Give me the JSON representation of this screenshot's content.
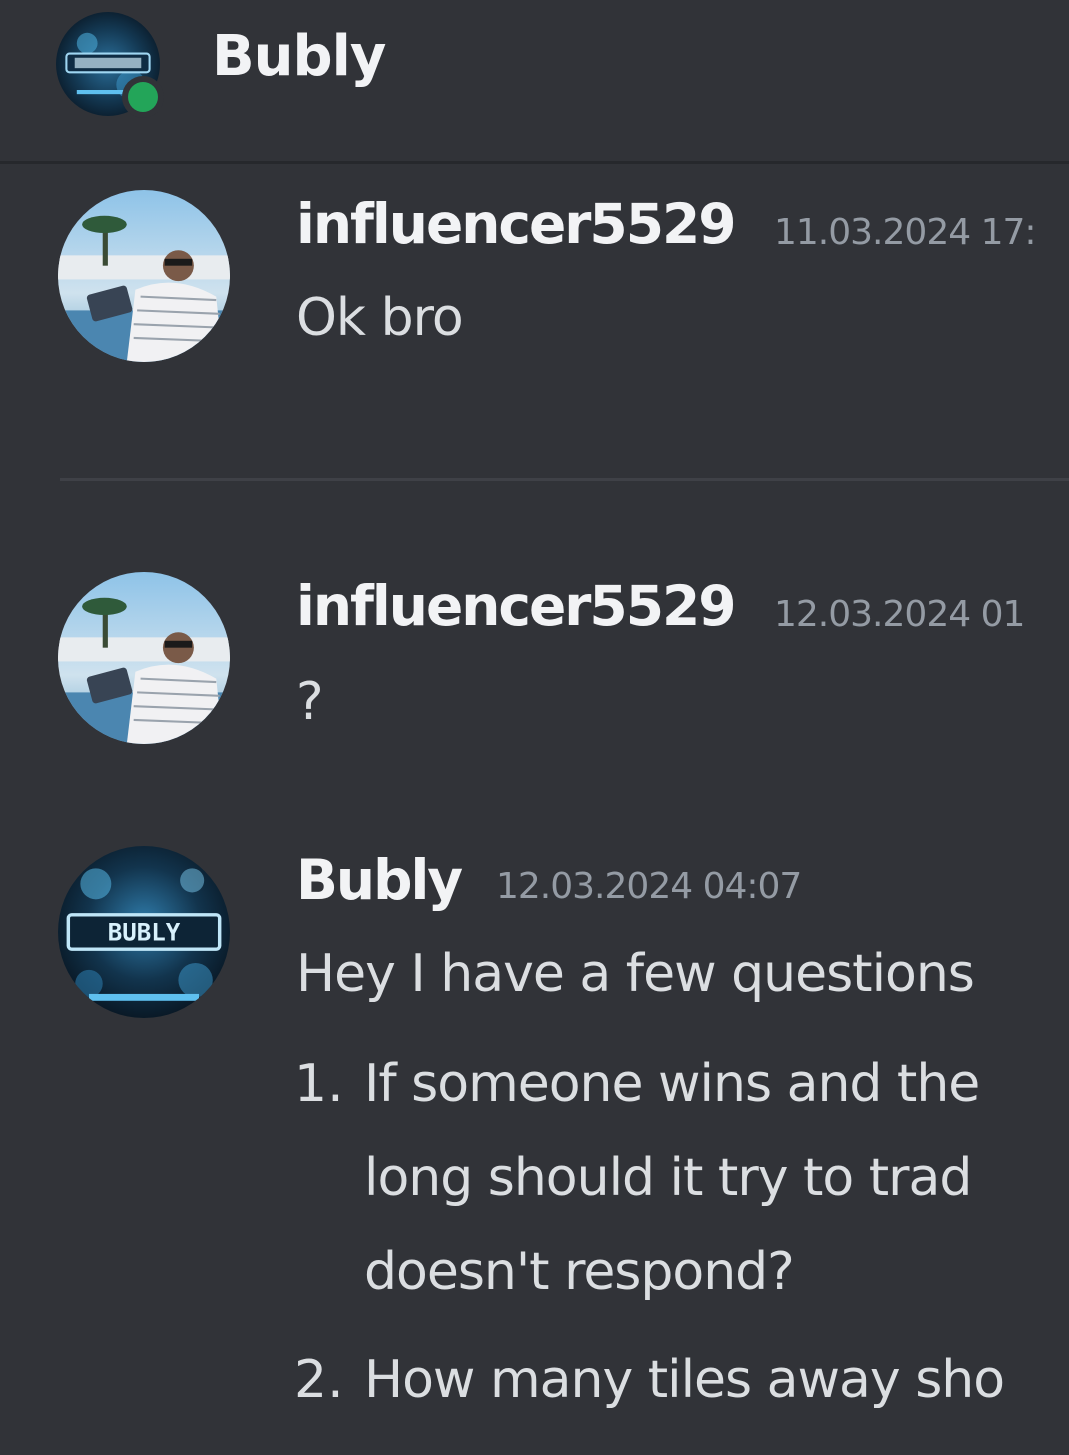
{
  "header": {
    "title": "Bubly",
    "avatar_icon": "bubly-avatar-icon",
    "status": "online",
    "status_color": "#23a559"
  },
  "messages": [
    {
      "author": "influencer5529",
      "timestamp": "11.03.2024 17:",
      "text": "Ok bro",
      "avatar_icon": "user-photo-avatar-icon"
    },
    {
      "author": "influencer5529",
      "timestamp": "12.03.2024 01",
      "text": "?",
      "avatar_icon": "user-photo-avatar-icon"
    },
    {
      "author": "Bubly",
      "timestamp": "12.03.2024 04:07",
      "text": "Hey I have a few questions",
      "avatar_icon": "bubly-avatar-icon",
      "list": [
        {
          "number": "1.",
          "lines": [
            "If someone wins and the",
            "long should it try to trad",
            "doesn't respond?"
          ]
        },
        {
          "number": "2.",
          "lines": [
            "How many tiles away sho"
          ]
        }
      ]
    }
  ],
  "colors": {
    "background": "#313338",
    "author": "#f2f3f5",
    "timestamp": "#949ba4",
    "text": "#dbdee1"
  }
}
